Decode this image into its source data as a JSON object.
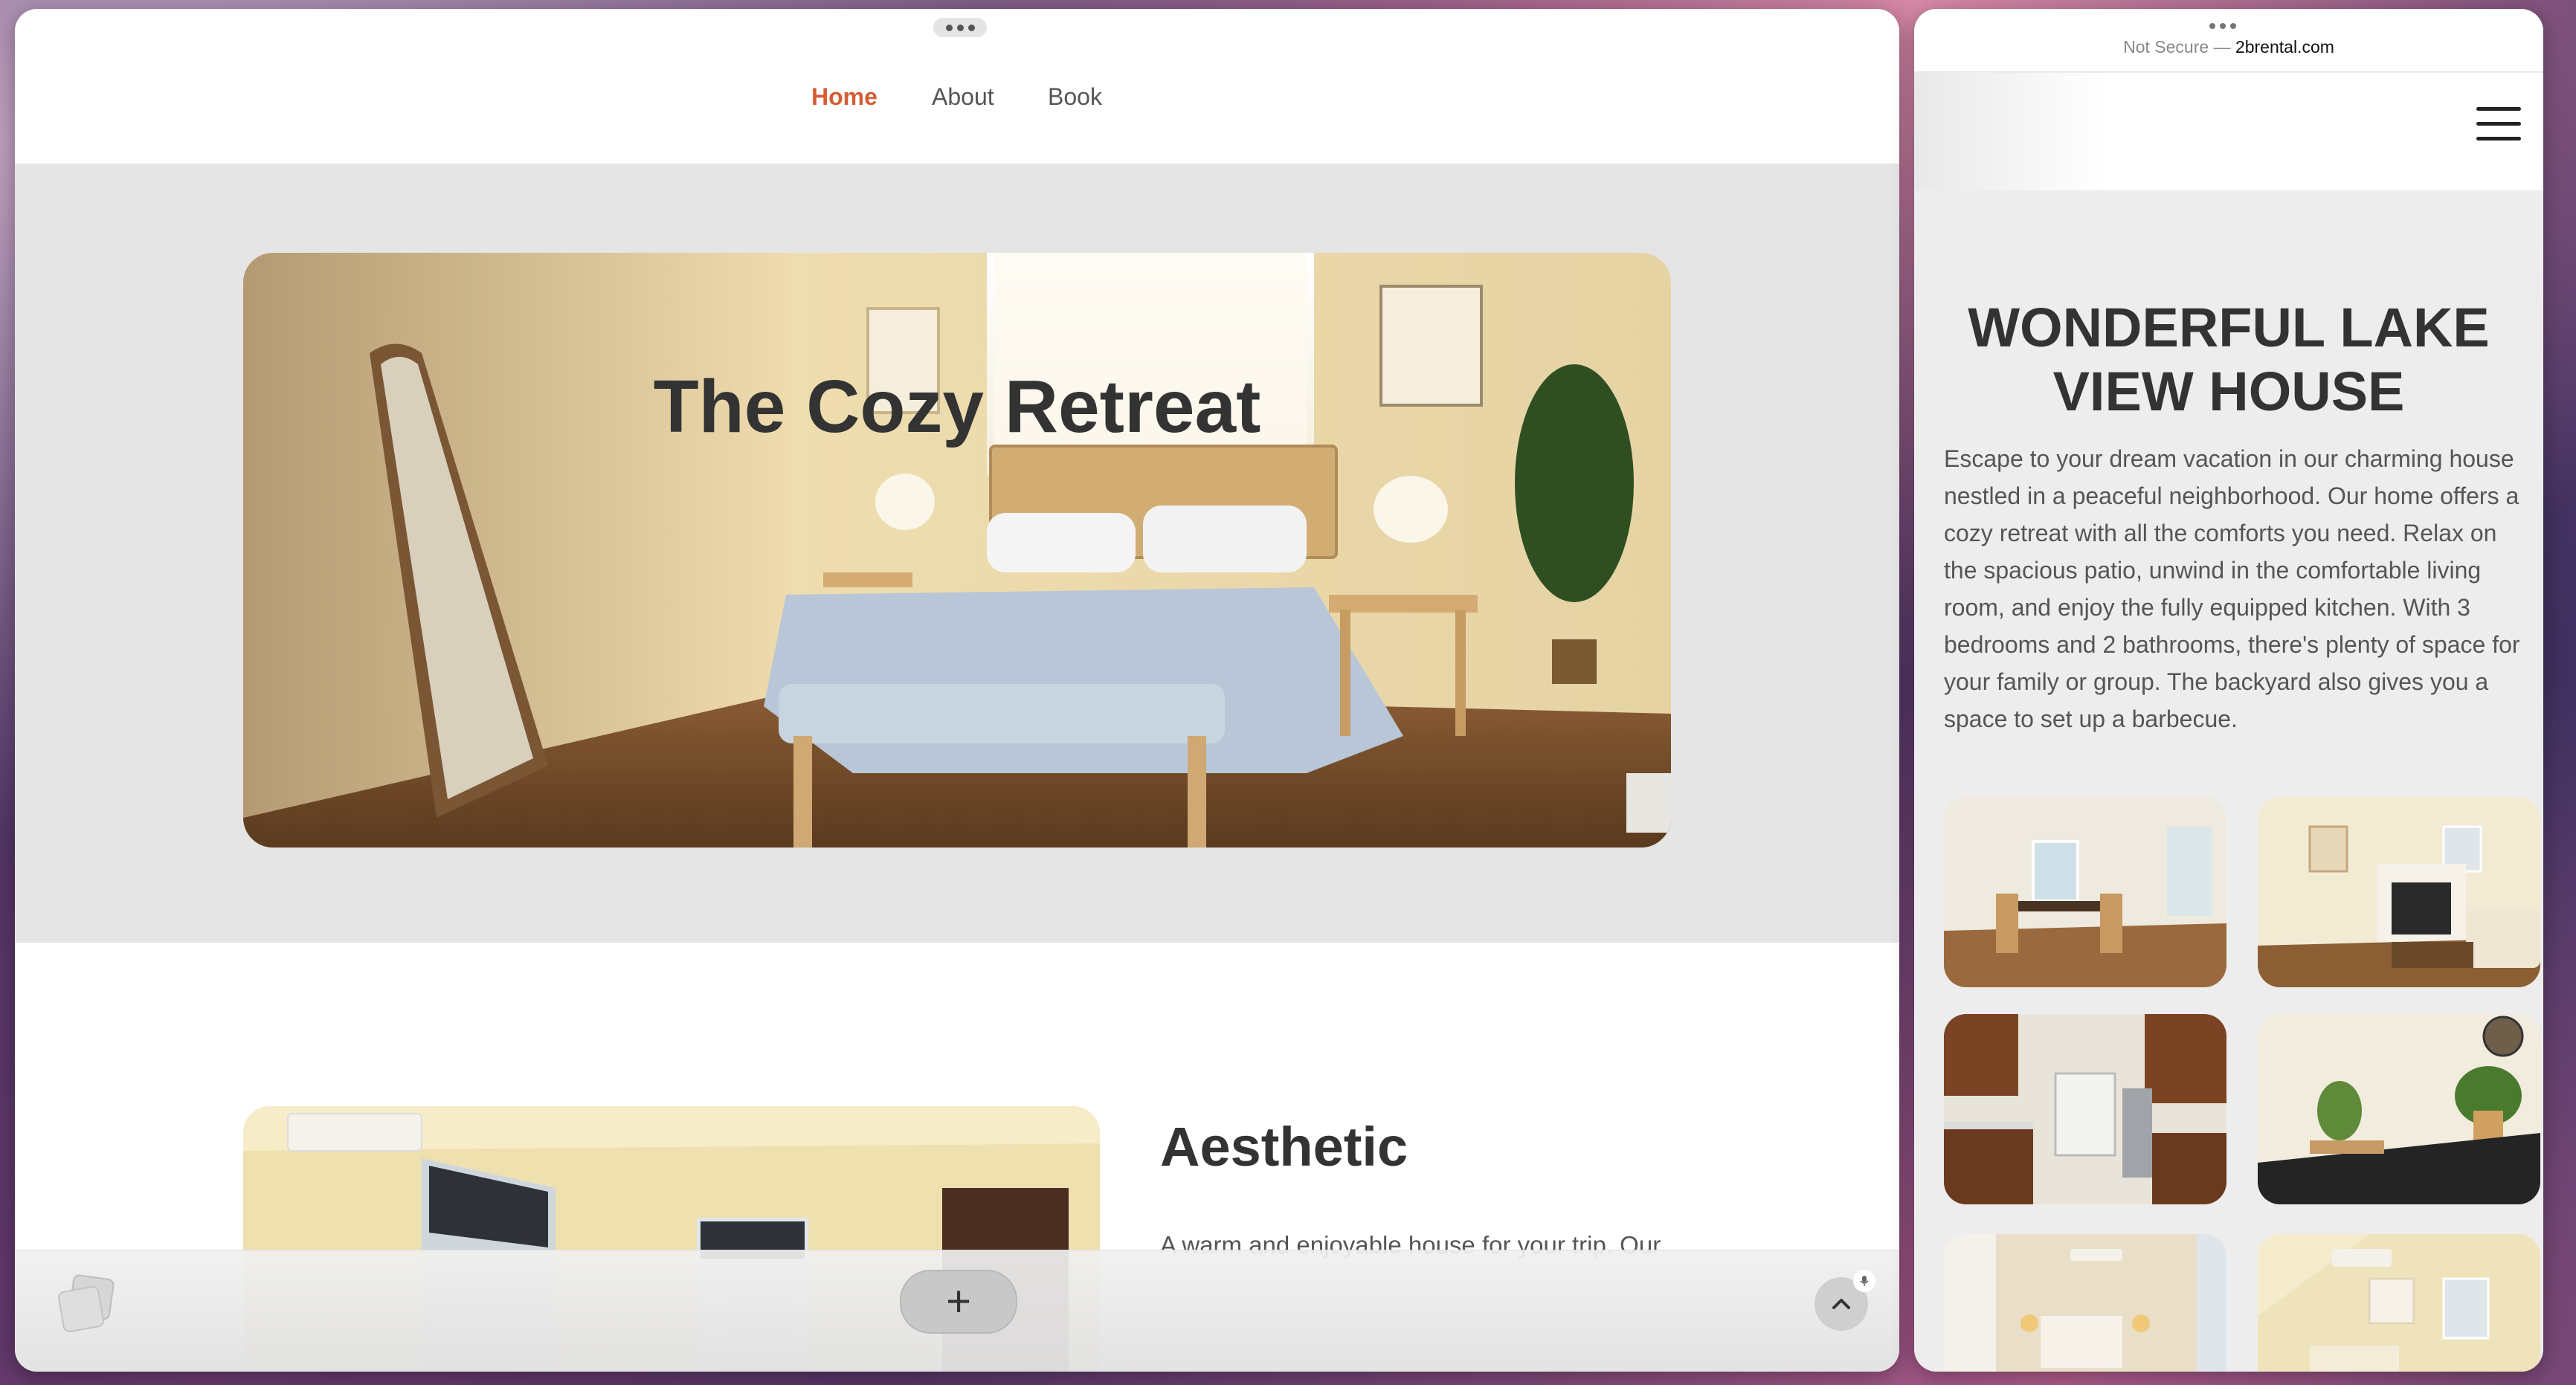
{
  "left_window": {
    "nav": {
      "home": "Home",
      "about": "About",
      "book": "Book"
    },
    "hero": {
      "title": "The Cozy Retreat"
    },
    "aesthetic": {
      "title": "Aesthetic",
      "text": "A warm and enjoyable house for your trip. Our"
    }
  },
  "right_window": {
    "url": {
      "security": "Not Secure",
      "separator": "—",
      "domain": "2brental.com"
    },
    "title": "WONDERFUL LAKE VIEW HOUSE",
    "description": "Escape to your dream vacation in our charming house nestled in a peaceful neighborhood. Our home offers a cozy retreat with all the comforts you need. Relax on the spacious patio, unwind in the comfortable living room, and enjoy the fully equipped kitchen. With 3 bedrooms and 2 bathrooms, there's plenty of space for your family or group. The backyard also gives you a space to set up a barbecue."
  },
  "icons": {
    "tabs": "tabs-icon",
    "new_tab": "plus-icon",
    "scroll_up": "chevron-up-icon",
    "menu": "hamburger-menu-icon",
    "mic": "microphone-icon"
  },
  "colors": {
    "accent": "#d45d33",
    "heading": "#333333",
    "body_text": "#555555"
  }
}
